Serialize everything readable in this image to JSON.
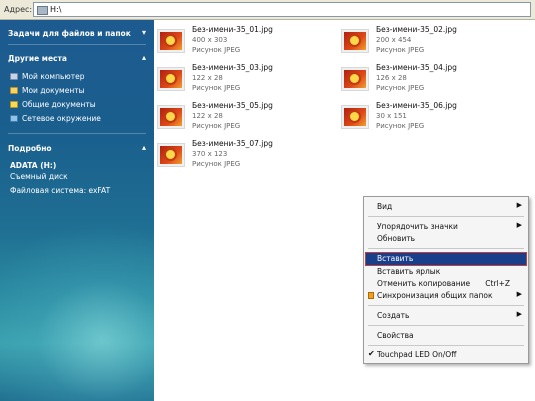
{
  "address": {
    "label": "Адрес:",
    "value": "H:\\"
  },
  "pane": {
    "tasks": {
      "title": "Задачи для файлов и папок"
    },
    "places": {
      "title": "Другие места",
      "items": [
        {
          "label": "Мой компьютер",
          "icon": "computer-icon"
        },
        {
          "label": "Мои документы",
          "icon": "documents-folder-icon"
        },
        {
          "label": "Общие документы",
          "icon": "shared-folder-icon"
        },
        {
          "label": "Сетевое окружение",
          "icon": "network-icon"
        }
      ]
    },
    "details": {
      "title": "Подробно",
      "drive": "ADATA (H:)",
      "type": "Съемный диск",
      "fs": "Файловая система: exFAT"
    }
  },
  "files": [
    {
      "name": "Без-имени-35_01.jpg",
      "dims": "400 x 303",
      "type": "Рисунок JPEG"
    },
    {
      "name": "Без-имени-35_02.jpg",
      "dims": "200 x 454",
      "type": "Рисунок JPEG"
    },
    {
      "name": "Без-имени-35_03.jpg",
      "dims": "122 x 28",
      "type": "Рисунок JPEG"
    },
    {
      "name": "Без-имени-35_04.jpg",
      "dims": "126 x 28",
      "type": "Рисунок JPEG"
    },
    {
      "name": "Без-имени-35_05.jpg",
      "dims": "122 x 28",
      "type": "Рисунок JPEG"
    },
    {
      "name": "Без-имени-35_06.jpg",
      "dims": "30 x 151",
      "type": "Рисунок JPEG"
    },
    {
      "name": "Без-имени-35_07.jpg",
      "dims": "370 x 123",
      "type": "Рисунок JPEG"
    }
  ],
  "menu": {
    "view": "Вид",
    "arrange": "Упорядочить значки",
    "refresh": "Обновить",
    "paste": "Вставить",
    "paste_shortcut": "Вставить ярлык",
    "undo": "Отменить копирование",
    "undo_key": "Ctrl+Z",
    "sync": "Синхронизация общих папок",
    "create": "Создать",
    "properties": "Свойства",
    "touchpad": "Touchpad LED On/Off"
  }
}
